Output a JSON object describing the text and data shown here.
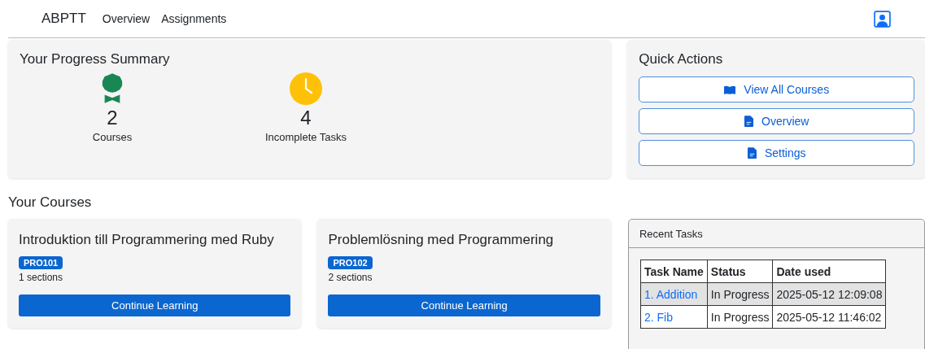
{
  "navbar": {
    "brand": "ABPTT",
    "links": [
      "Overview",
      "Assignments"
    ]
  },
  "progress": {
    "title": "Your Progress Summary",
    "stats": [
      {
        "kind": "award",
        "value": "2",
        "label": "Courses"
      },
      {
        "kind": "clock",
        "value": "4",
        "label": "Incomplete Tasks"
      }
    ]
  },
  "quick_actions": {
    "title": "Quick Actions",
    "buttons": [
      {
        "kind": "book",
        "label": "View All Courses"
      },
      {
        "kind": "file",
        "label": "Overview"
      },
      {
        "kind": "file",
        "label": "Settings"
      }
    ]
  },
  "courses_heading": "Your Courses",
  "courses": [
    {
      "title": "Introduktion till Programmering med Ruby",
      "code": "PRO101",
      "sections": "1 sections",
      "button": "Continue Learning"
    },
    {
      "title": "Problemlösning med Programmering",
      "code": "PRO102",
      "sections": "2 sections",
      "button": "Continue Learning"
    }
  ],
  "recent_tasks": {
    "title": "Recent Tasks",
    "columns": [
      "Task Name",
      "Status",
      "Date used"
    ],
    "rows": [
      {
        "name": "1. Addition",
        "status": "In Progress",
        "date": "2025-05-12 12:09:08",
        "selected": true
      },
      {
        "name": "2. Fib",
        "status": "In Progress",
        "date": "2025-05-12 11:46:02",
        "selected": false
      }
    ]
  }
}
